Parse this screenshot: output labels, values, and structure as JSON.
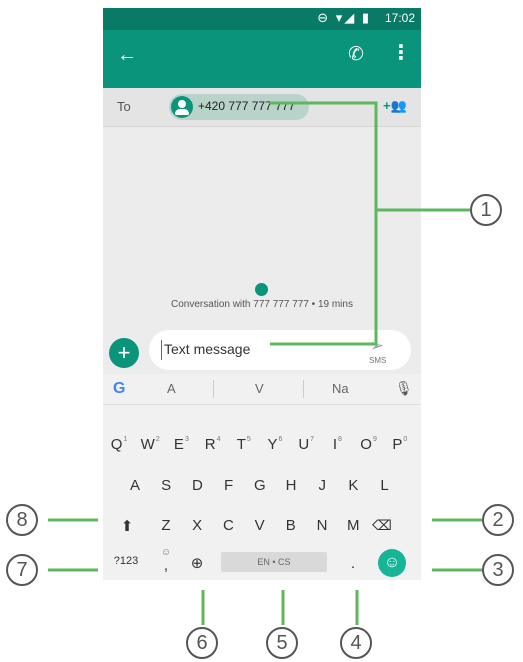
{
  "status_bar": {
    "time": "17:02",
    "icons": "⊖ ▾◢ ▮"
  },
  "toolbar": {
    "back_icon": "←",
    "call_icon": "✆",
    "more_icon": "⋮"
  },
  "recipient": {
    "to_label": "To",
    "number": "+420 777 777 777",
    "add_icon": "+👥"
  },
  "conversation": {
    "info": "Conversation with 777 777 777 • 19 mins"
  },
  "compose": {
    "add_icon": "+",
    "placeholder": "Text message",
    "send_icon": "➢",
    "sms_label": "SMS"
  },
  "keyboard": {
    "suggestions": [
      "A",
      "V",
      "Na"
    ],
    "g_logo": "G",
    "mic_icon": "🎙",
    "row1": [
      {
        "k": "Q",
        "n": "1"
      },
      {
        "k": "W",
        "n": "2"
      },
      {
        "k": "E",
        "n": "3"
      },
      {
        "k": "R",
        "n": "4"
      },
      {
        "k": "T",
        "n": "5"
      },
      {
        "k": "Y",
        "n": "6"
      },
      {
        "k": "U",
        "n": "7"
      },
      {
        "k": "I",
        "n": "8"
      },
      {
        "k": "O",
        "n": "9"
      },
      {
        "k": "P",
        "n": "0"
      }
    ],
    "row2": [
      "A",
      "S",
      "D",
      "F",
      "G",
      "H",
      "J",
      "K",
      "L"
    ],
    "row3": [
      "Z",
      "X",
      "C",
      "V",
      "B",
      "N",
      "M"
    ],
    "shift_icon": "⬆",
    "backspace_icon": "⌫",
    "symbols_label": "?123",
    "comma_key": ",",
    "comma_hint": "☺",
    "globe_icon": "⊕",
    "space_label": "EN • CS",
    "period_key": ".",
    "emoji_icon": "☺"
  },
  "callouts": [
    "1",
    "2",
    "3",
    "4",
    "5",
    "6",
    "7",
    "8"
  ],
  "colors": {
    "primary": "#0b947c",
    "status_bar": "#087a66",
    "accent": "#16b598",
    "callout_line": "#5cb85c"
  }
}
